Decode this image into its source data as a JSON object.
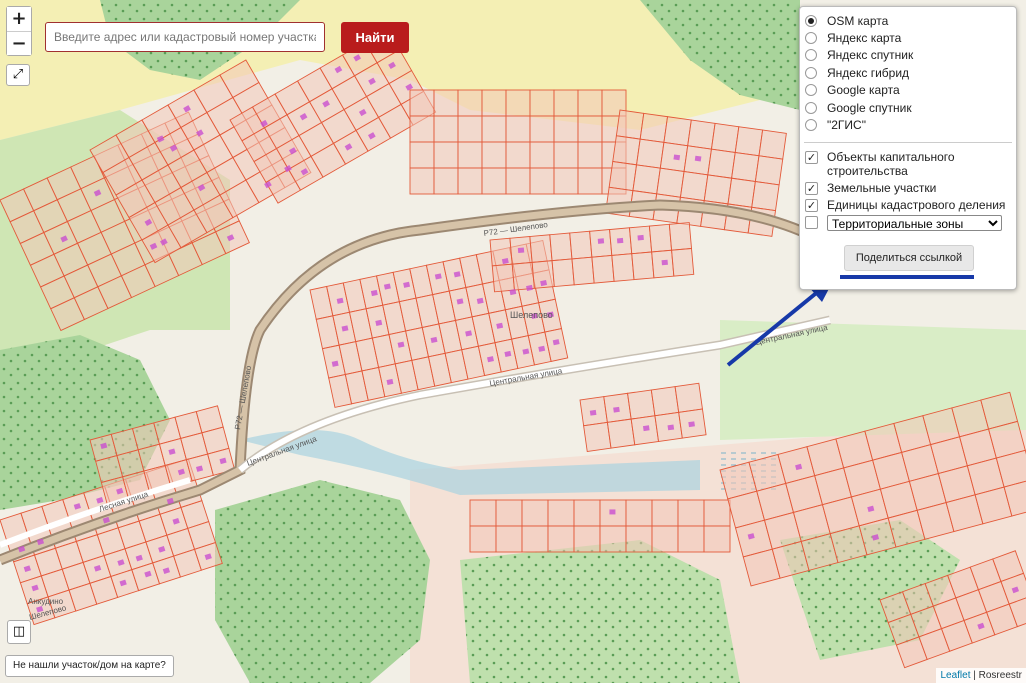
{
  "colors": {
    "find_button": "#b91c1c",
    "parcel_stroke": "#e35a3a",
    "parcel_fill": "#f3c6b8",
    "building": "#c94fd0",
    "forest": "#6fb26a",
    "road": "#b9a38a",
    "share_underline": "#1739a8",
    "annotation_arrow": "#1739a8"
  },
  "controls": {
    "zoom_in": "+",
    "zoom_out": "−",
    "fullscreen_icon": "expand-icon"
  },
  "search": {
    "placeholder": "Введите адрес или кадастровый номер участка",
    "value": "",
    "button_label": "Найти"
  },
  "layers": {
    "base_layers": [
      {
        "label": "OSM карта",
        "selected": true
      },
      {
        "label": "Яндекс карта",
        "selected": false
      },
      {
        "label": "Яндекс спутник",
        "selected": false
      },
      {
        "label": "Яндекс гибрид",
        "selected": false
      },
      {
        "label": "Google карта",
        "selected": false
      },
      {
        "label": "Google спутник",
        "selected": false
      },
      {
        "label": "\"2ГИС\"",
        "selected": false
      }
    ],
    "overlays": [
      {
        "label": "Объекты капитального строительства",
        "checked": true
      },
      {
        "label": "Земельные участки",
        "checked": true
      },
      {
        "label": "Единицы кадастрового деления",
        "checked": true
      }
    ],
    "zones_checked": false,
    "zones_select": "Территориальные зоны",
    "share_label": "Поделиться ссылкой"
  },
  "map_labels": {
    "road_r72_top": "Р72 — Шелепово",
    "road_r72_left": "Р72 — Шелепово",
    "village": "Шелепово",
    "central_street_1": "Центральная улица",
    "central_street_2": "Центральная улица",
    "central_street_3": "Центральная улица",
    "forest_street": "Лесная улица",
    "village_sw": "Анкудино",
    "street_sw": "Шелепово"
  },
  "bottom": {
    "legend_icon": "legend-icon",
    "not_found": "Не нашли участок/дом на карте?",
    "attribution_leaflet": "Leaflet",
    "attribution_sep": " | ",
    "attribution_source": "Rosreestr"
  }
}
